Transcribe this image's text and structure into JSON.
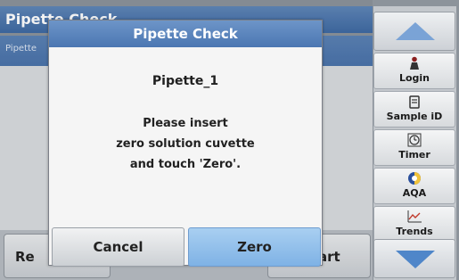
{
  "background": {
    "title": "Pipette Check",
    "subtitle": "Pipette",
    "left_button_label": "Re",
    "right_button_label": "art"
  },
  "sidebar": {
    "buttons": [
      {
        "label": "Login",
        "icon": "person-icon"
      },
      {
        "label": "Sample iD",
        "icon": "sample-id-icon"
      },
      {
        "label": "Timer",
        "icon": "timer-icon"
      },
      {
        "label": "AQA",
        "icon": "aqa-icon"
      },
      {
        "label": "Trends",
        "icon": "trends-icon"
      }
    ]
  },
  "dialog": {
    "title": "Pipette Check",
    "pipette_name": "Pipette_1",
    "message_lines": [
      "Please insert",
      "zero solution cuvette",
      "and touch 'Zero'."
    ],
    "cancel_label": "Cancel",
    "zero_label": "Zero"
  },
  "colors": {
    "title_bar_blue": "#4b77b2",
    "zero_button_blue": "#7fb2e5",
    "arrow_blue": "#4f86c9"
  }
}
